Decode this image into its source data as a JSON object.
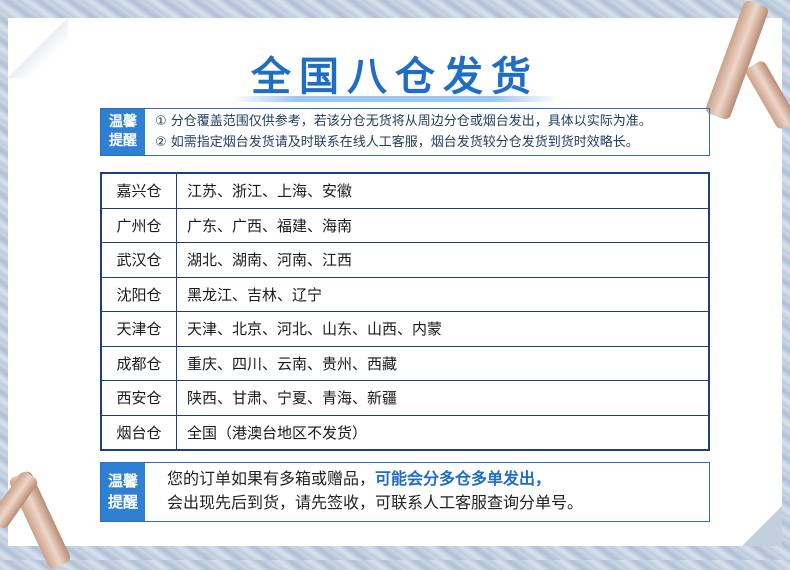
{
  "title": "全国八仓发货",
  "notice": {
    "badge": [
      "温馨",
      "提醒"
    ],
    "lines": [
      "① 分仓覆盖范围仅供参考，若该分仓无货将从周边分仓或烟台发出，具体以实际为准。",
      "② 如需指定烟台发货请及时联系在线人工客服，烟台发货较分仓发货到货时效略长。"
    ]
  },
  "warehouses": [
    {
      "name": "嘉兴仓",
      "area": "江苏、浙江、上海、安徽"
    },
    {
      "name": "广州仓",
      "area": "广东、广西、福建、海南"
    },
    {
      "name": "武汉仓",
      "area": "湖北、湖南、河南、江西"
    },
    {
      "name": "沈阳仓",
      "area": "黑龙江、吉林、辽宁"
    },
    {
      "name": "天津仓",
      "area": "天津、北京、河北、山东、山西、内蒙"
    },
    {
      "name": "成都仓",
      "area": "重庆、四川、云南、贵州、西藏"
    },
    {
      "name": "西安仓",
      "area": "陕西、甘肃、宁夏、青海、新疆"
    },
    {
      "name": "烟台仓",
      "area": "全国（港澳台地区不发货）"
    }
  ],
  "bottom_notice": {
    "badge": [
      "温馨",
      "提醒"
    ],
    "line1_prefix": "您的订单如果有多箱或赠品，",
    "line1_highlight": "可能会分多仓多单发出，",
    "line2": "会出现先后到货，请先签收，可联系人工客服查询分单号。"
  },
  "colors": {
    "accent": "#1f6dc4",
    "badge": "#2f7fd3",
    "table_border": "#1d3f7a"
  }
}
